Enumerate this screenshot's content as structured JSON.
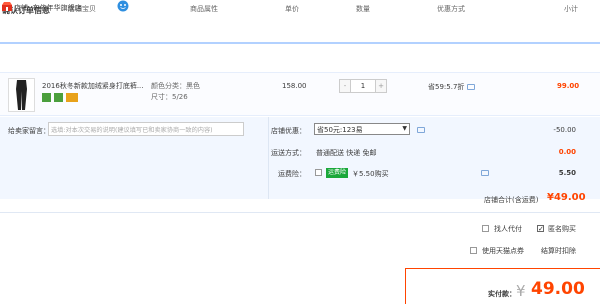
{
  "page_title": "确认订单信息",
  "columns": [
    "店铺宝贝",
    "商品属性",
    "单价",
    "数量",
    "优惠方式",
    "小计"
  ],
  "shop": {
    "label": "店铺: 布依年华旗舰店"
  },
  "item": {
    "title": "2016秋冬新款加绒紧身打底裤...",
    "sku_color": "颜色分类：黑色",
    "sku_size": "尺寸：5/26",
    "price": "158.00",
    "quantity": "1",
    "minus": "-",
    "plus": "+",
    "promo": "省59:5.7折",
    "subtotal": "99.00",
    "badge_colors": [
      "#4b9f3d",
      "#4b9f3d",
      "#e8a21b"
    ]
  },
  "message": {
    "label": "给卖家留言：",
    "placeholder": "选填:对本次交易的说明(建议填写已和卖家协商一致的内容)"
  },
  "discount": {
    "label": "店铺优惠：",
    "selected": "省50元:123易",
    "value": "-50.00"
  },
  "shipping": {
    "label": "运送方式：",
    "text": "普通配送 快递 免邮",
    "value": "0.00"
  },
  "insurance": {
    "label": "运费险：",
    "tag": "运费险",
    "text": "￥5.50购买",
    "value": "5.50"
  },
  "shop_total": {
    "label": "店铺合计(含运费)",
    "value": "¥49.00"
  },
  "options": {
    "agent_pay": "找人代付",
    "anonymous": "匿名购买",
    "use_points": "使用天猫点券",
    "points_note": "结算时扣除"
  },
  "payment": {
    "label": "实付款：",
    "yen": "¥",
    "value": "49.00"
  },
  "colors": {
    "accent": "#ff4400",
    "header_line": "#b2d1ff",
    "panel_bg": "#f2f7ff"
  }
}
